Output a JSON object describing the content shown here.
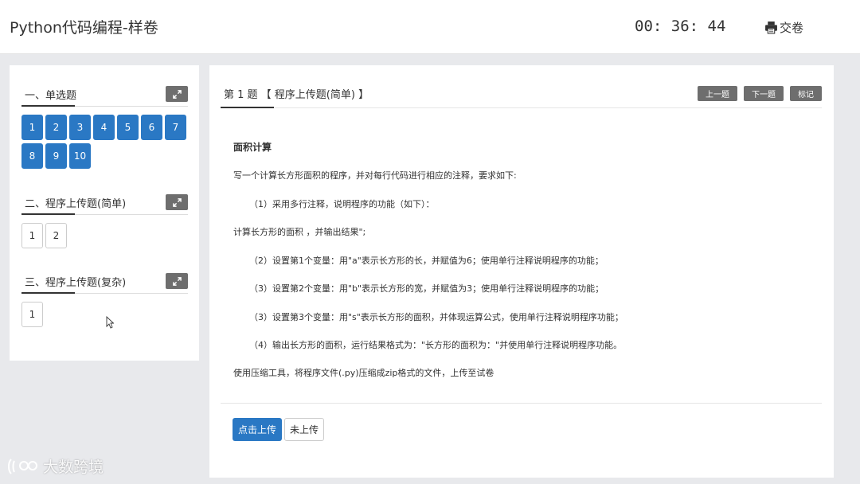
{
  "header": {
    "title": "Python代码编程-样卷",
    "timer": "00: 36: 44",
    "submit_label": "交卷",
    "submit_icon": "printer-icon"
  },
  "sidebar": {
    "sections": [
      {
        "title": "一、单选题",
        "items": [
          "1",
          "2",
          "3",
          "4",
          "5",
          "6",
          "7",
          "8",
          "9",
          "10"
        ],
        "state": "answered"
      },
      {
        "title": "二、程序上传题(简单)",
        "items": [
          "1",
          "2"
        ],
        "state": "unanswered"
      },
      {
        "title": "三、程序上传题(复杂)",
        "items": [
          "1"
        ],
        "state": "unanswered"
      }
    ],
    "expand_icon": "expand-icon"
  },
  "question": {
    "title": "第 1 题 【 程序上传题(简单) 】",
    "nav": {
      "prev": "上一题",
      "next": "下一题",
      "mark": "标记"
    },
    "heading": "面积计算",
    "lines": [
      "写一个计算长方形面积的程序，并对每行代码进行相应的注释，要求如下:",
      "（1）采用多行注释，说明程序的功能（如下）：",
      "计算长方形的面积 ，并输出结果\";",
      "（2）设置第1个变量：用\"a\"表示长方形的长，并赋值为6；使用单行注释说明程序的功能；",
      "（3）设置第2个变量：用\"b\"表示长方形的宽，并赋值为3；使用单行注释说明程序的功能；",
      "（3）设置第3个变量：用\"s\"表示长方形的面积，并体现运算公式，使用单行注释说明程序功能；",
      "（4）输出长方形的面积，运行结果格式为：\"长方形的面积为：\"并使用单行注释说明程序功能。",
      "使用压缩工具，将程序文件(.py)压缩成zip格式的文件，上传至试卷"
    ],
    "upload_label": "点击上传",
    "status_label": "未上传"
  },
  "watermark": {
    "text": "大数跨境"
  },
  "colors": {
    "accent": "#2a78c4",
    "dark_button": "#6e6e6e",
    "background": "#e8e9ec"
  }
}
